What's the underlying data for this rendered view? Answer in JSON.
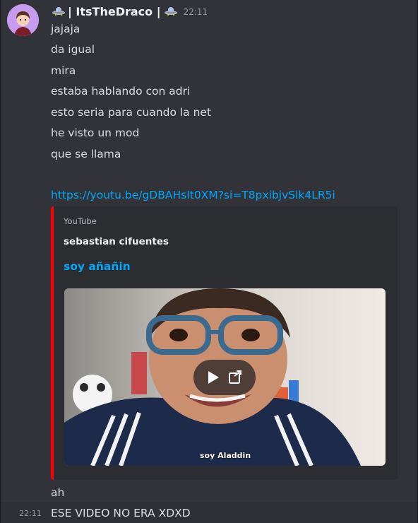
{
  "message": {
    "username": "| ItsTheDraco |",
    "timestamp": "22:11",
    "lines": [
      "jajaja",
      "da igual",
      "mira",
      "estaba hablando con adri",
      "esto seria para cuando la net",
      "he visto un mod",
      "que se llama"
    ],
    "link": "https://youtu.be/gDBAHsIt0XM?si=T8pxibjvSlk4LR5i"
  },
  "embed": {
    "provider": "YouTube",
    "author": "sebastian cifuentes",
    "title": "soy añañin",
    "thumbnail_caption": "soy Aladdin",
    "accent_color": "#ff0000"
  },
  "followups": [
    {
      "text": "ah"
    },
    {
      "timestamp": "22:11",
      "text": "ESE VIDEO NO ERA XDXD"
    }
  ],
  "icons": {
    "username_decoration": "ufo-icon",
    "play": "play-icon",
    "open_external": "open-external-icon"
  },
  "colors": {
    "background": "#313338",
    "link": "#00a8fc",
    "embed_bg": "#2b2d31"
  }
}
